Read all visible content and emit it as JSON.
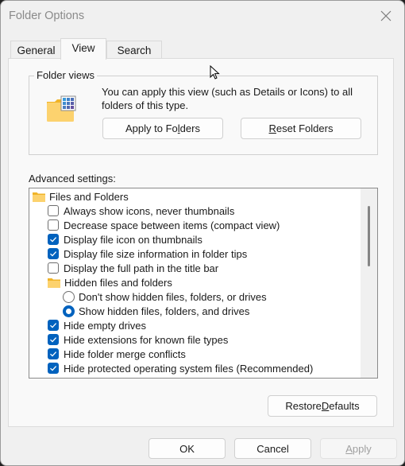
{
  "window": {
    "title": "Folder Options"
  },
  "tabs": [
    {
      "label": "General",
      "active": false
    },
    {
      "label": "View",
      "active": true
    },
    {
      "label": "Search",
      "active": false
    }
  ],
  "folder_views": {
    "legend": "Folder views",
    "description": "You can apply this view (such as Details or Icons) to all folders of this type.",
    "apply_button": {
      "pre": "Apply to Fo",
      "accel": "l",
      "post": "ders"
    },
    "reset_button": {
      "pre": "",
      "accel": "R",
      "post": "eset Folders"
    }
  },
  "advanced": {
    "label": "Advanced settings:",
    "items": [
      {
        "type": "folder",
        "label": "Files and Folders",
        "level": 0
      },
      {
        "type": "checkbox",
        "label": "Always show icons, never thumbnails",
        "checked": false,
        "level": 1
      },
      {
        "type": "checkbox",
        "label": "Decrease space between items (compact view)",
        "checked": false,
        "level": 1
      },
      {
        "type": "checkbox",
        "label": "Display file icon on thumbnails",
        "checked": true,
        "level": 1
      },
      {
        "type": "checkbox",
        "label": "Display file size information in folder tips",
        "checked": true,
        "level": 1
      },
      {
        "type": "checkbox",
        "label": "Display the full path in the title bar",
        "checked": false,
        "level": 1
      },
      {
        "type": "folder",
        "label": "Hidden files and folders",
        "level": 1
      },
      {
        "type": "radio",
        "label": "Don't show hidden files, folders, or drives",
        "checked": false,
        "level": 2
      },
      {
        "type": "radio",
        "label": "Show hidden files, folders, and drives",
        "checked": true,
        "level": 2
      },
      {
        "type": "checkbox",
        "label": "Hide empty drives",
        "checked": true,
        "level": 1
      },
      {
        "type": "checkbox",
        "label": "Hide extensions for known file types",
        "checked": true,
        "level": 1
      },
      {
        "type": "checkbox",
        "label": "Hide folder merge conflicts",
        "checked": true,
        "level": 1
      },
      {
        "type": "checkbox",
        "label": "Hide protected operating system files (Recommended)",
        "checked": true,
        "level": 1
      }
    ]
  },
  "restore_button": {
    "pre": "Restore ",
    "accel": "D",
    "post": "efaults"
  },
  "footer": {
    "ok": "OK",
    "cancel": "Cancel",
    "apply": {
      "pre": "",
      "accel": "A",
      "post": "pply",
      "disabled": true
    }
  },
  "colors": {
    "accent": "#0062be"
  }
}
